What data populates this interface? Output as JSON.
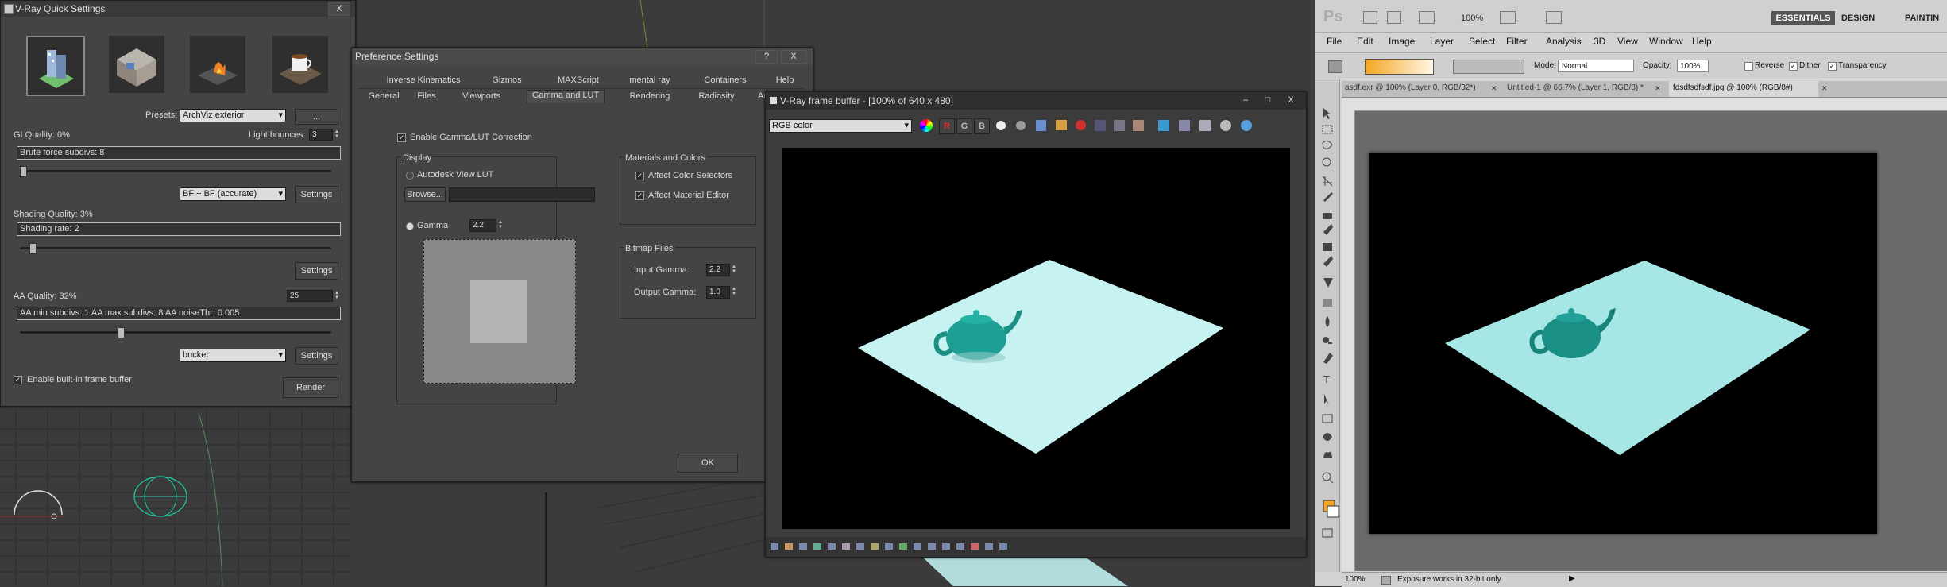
{
  "vray_quick": {
    "title": "V-Ray Quick Settings",
    "presets_label": "Presets:",
    "presets_value": "ArchViz exterior",
    "more_button": "...",
    "gi_quality": "GI Quality: 0%",
    "light_bounces_label": "Light bounces:",
    "light_bounces_value": "3",
    "gi_bar_text": "Brute force subdivs: 8",
    "gi_slider": 0.0,
    "gi_engine": "BF + BF  (accurate)",
    "settings_label": "Settings",
    "shading_quality": "Shading Quality: 3%",
    "shading_bar_text": "Shading rate: 2",
    "shading_slider": 0.03,
    "aa_quality": "AA Quality: 32%",
    "aa_value": "25",
    "aa_bar_text": "AA min subdivs: 1   AA max subdivs: 8   AA noiseThr: 0.005",
    "aa_slider": 0.32,
    "aa_sampler": "bucket",
    "enable_fb_label": "Enable built-in frame buffer",
    "render_button": "Render",
    "close": "X"
  },
  "prefs": {
    "title": "Preference Settings",
    "help": "?",
    "close": "X",
    "tabs_row1": [
      "Inverse Kinematics",
      "Gizmos",
      "MAXScript",
      "mental ray",
      "Containers",
      "Help"
    ],
    "tabs_row2": [
      "General",
      "Files",
      "Viewports",
      "Gamma and LUT",
      "Rendering",
      "Radiosity",
      "Ani"
    ],
    "enable_gamma": "Enable Gamma/LUT Correction",
    "display_group": "Display",
    "autodesk_lut": "Autodesk View LUT",
    "browse": "Browse...",
    "gamma_label": "Gamma",
    "gamma_value": "2.2",
    "materials_group": "Materials and Colors",
    "affect_color": "Affect Color Selectors",
    "affect_material": "Affect Material Editor",
    "bitmap_group": "Bitmap Files",
    "input_gamma_label": "Input Gamma:",
    "input_gamma_value": "2.2",
    "output_gamma_label": "Output Gamma:",
    "output_gamma_value": "1.0",
    "ok": "OK"
  },
  "vfb": {
    "title": "V-Ray frame buffer - [100% of 640 x 480]",
    "channel": "RGB color",
    "r": "R",
    "g": "G",
    "b": "B",
    "minimize": "–",
    "maximize": "□",
    "close": "X"
  },
  "ps": {
    "logo": "Ps",
    "zoom": "100%",
    "workspaces": [
      "ESSENTIALS",
      "DESIGN",
      "PAINTIN"
    ],
    "menu": [
      "File",
      "Edit",
      "Image",
      "Layer",
      "Select",
      "Filter",
      "Analysis",
      "3D",
      "View",
      "Window",
      "Help"
    ],
    "mode_label": "Mode:",
    "mode_value": "Normal",
    "opacity_label": "Opacity:",
    "opacity_value": "100%",
    "reverse": "Reverse",
    "dither": "Dither",
    "transparency": "Transparency",
    "doc_tabs": [
      "asdf.exr @ 100% (Layer 0, RGB/32*)",
      "Untitled-1 @ 66.7% (Layer 1, RGB/8) *",
      "fdsdfsdfsdf.jpg @ 100% (RGB/8#)"
    ],
    "status_zoom": "100%",
    "status_text": "Exposure works in 32-bit only"
  },
  "colors": {
    "dark_panel": "#444444",
    "ps_bg": "#d4d4d4",
    "ps_canvas_bg": "#6a6a6a",
    "plane": "#b8efee",
    "teapot": "#1e9f94",
    "swatch_fg": "#f4a623"
  }
}
